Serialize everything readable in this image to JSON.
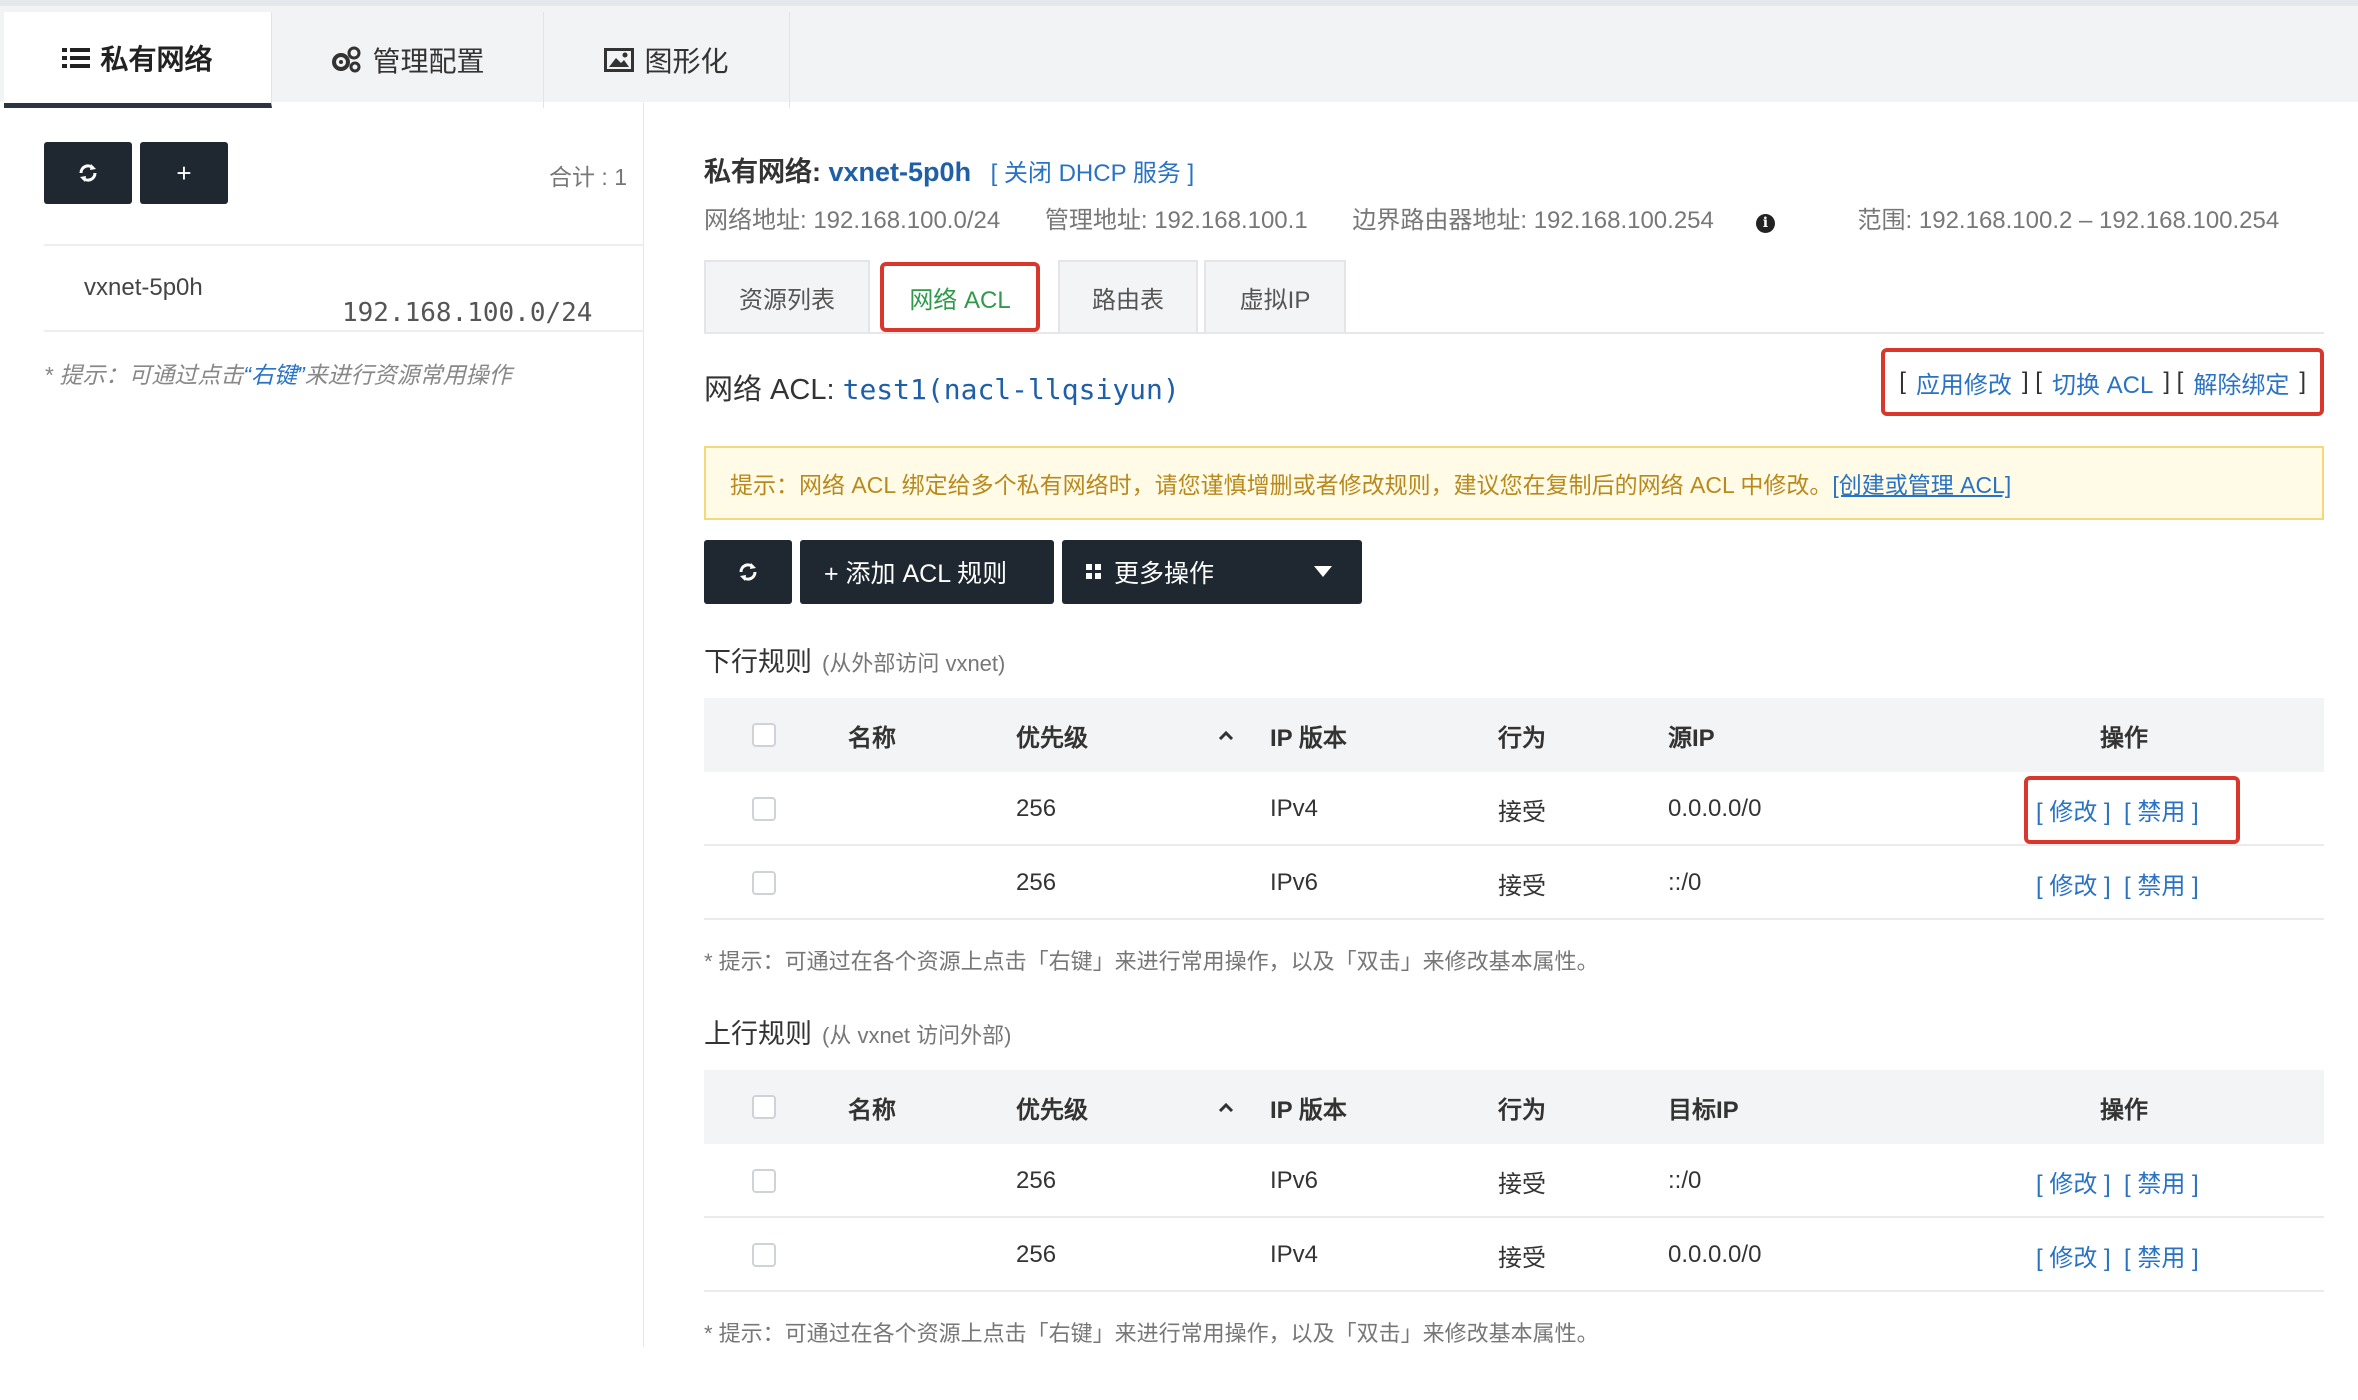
{
  "top_tabs": [
    {
      "label": "私有网络",
      "icon": "list-icon"
    },
    {
      "label": "管理配置",
      "icon": "gears-icon"
    },
    {
      "label": "图形化",
      "icon": "image-icon"
    }
  ],
  "sidebar": {
    "refresh_icon": "refresh-icon",
    "add_label": "+",
    "total": "合计 : 1",
    "item_name": "vxnet-5p0h",
    "item_ip": "192.168.100.0/24",
    "hint_prefix": "* 提示：可通过点击",
    "hint_key": "“右键”",
    "hint_suffix": "来进行资源常用操作"
  },
  "header": {
    "title_label": "私有网络:",
    "title_name": "vxnet-5p0h",
    "dhcp": "[ 关闭 DHCP 服务 ]",
    "network_addr": "网络地址: 192.168.100.0/24",
    "manage_addr": "管理地址: 192.168.100.1",
    "border_router": "边界路由器地址: 192.168.100.254",
    "range": "范围: 192.168.100.2 – 192.168.100.254"
  },
  "sub_tabs": [
    "资源列表",
    "网络 ACL",
    "路由表",
    "虚拟IP"
  ],
  "acl": {
    "label": "网络 ACL:",
    "name": "test1(nacl-llqsiyun)",
    "bracket_open": "[",
    "bracket_sep": "] [",
    "bracket_close": "]",
    "apply": "应用修改",
    "switch": "切换 ACL",
    "unbind": "解除绑定"
  },
  "warning": {
    "text": "提示：网络 ACL 绑定给多个私有网络时，请您谨慎增删或者修改规则，建议您在复制后的网络 ACL 中修改。",
    "link": "[创建或管理 ACL]"
  },
  "toolbar": {
    "add_rule": "+ 添加 ACL 规则",
    "more": "更多操作"
  },
  "inbound": {
    "title": "下行规则",
    "subtitle": "(从外部访问 vxnet)",
    "headers": [
      "名称",
      "优先级",
      "IP 版本",
      "行为",
      "源IP",
      "操作"
    ],
    "rows": [
      {
        "priority": "256",
        "ip_version": "IPv4",
        "action": "接受",
        "ip": "0.0.0.0/0",
        "edit": "[ 修改 ]",
        "disable": "[ 禁用 ]"
      },
      {
        "priority": "256",
        "ip_version": "IPv6",
        "action": "接受",
        "ip": "::/0",
        "edit": "[ 修改 ]",
        "disable": "[ 禁用 ]"
      }
    ],
    "tip": "* 提示：可通过在各个资源上点击「右键」来进行常用操作，以及「双击」来修改基本属性。"
  },
  "outbound": {
    "title": "上行规则",
    "subtitle": "(从 vxnet 访问外部)",
    "headers": [
      "名称",
      "优先级",
      "IP 版本",
      "行为",
      "目标IP",
      "操作"
    ],
    "rows": [
      {
        "priority": "256",
        "ip_version": "IPv6",
        "action": "接受",
        "ip": "::/0",
        "edit": "[ 修改 ]",
        "disable": "[ 禁用 ]"
      },
      {
        "priority": "256",
        "ip_version": "IPv4",
        "action": "接受",
        "ip": "0.0.0.0/0",
        "edit": "[ 修改 ]",
        "disable": "[ 禁用 ]"
      }
    ],
    "tip": "* 提示：可通过在各个资源上点击「右键」来进行常用操作，以及「双击」来修改基本属性。"
  },
  "colors": {
    "dark": "#1f2731",
    "link": "#2a73c4",
    "highlight": "#d9372b",
    "active_tab_text": "#2e9a4a"
  }
}
